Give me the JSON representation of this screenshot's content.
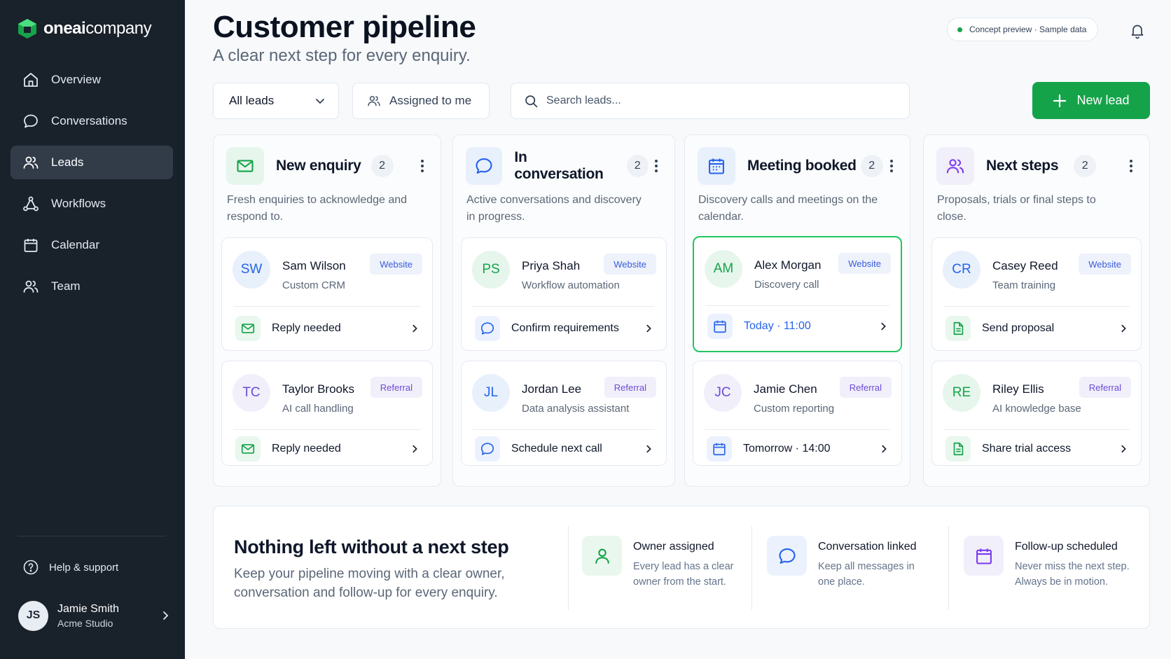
{
  "brand": {
    "name_bold": "oneai",
    "name_rest": "company"
  },
  "sidebar": {
    "items": [
      {
        "label": "Overview",
        "icon": "home-icon"
      },
      {
        "label": "Conversations",
        "icon": "chat-bubble-icon"
      },
      {
        "label": "Leads",
        "icon": "users-icon",
        "active": true
      },
      {
        "label": "Workflows",
        "icon": "workflow-icon"
      },
      {
        "label": "Calendar",
        "icon": "calendar-icon"
      },
      {
        "label": "Team",
        "icon": "team-icon"
      }
    ],
    "help": "Help & support",
    "user": {
      "initials": "JS",
      "name": "Jamie Smith",
      "org": "Acme Studio"
    }
  },
  "header": {
    "title": "Customer pipeline",
    "subtitle": "A clear next step for every enquiry.",
    "preview": "Concept preview · Sample data"
  },
  "toolbar": {
    "filter": "All leads",
    "assigned": "Assigned to me",
    "search_placeholder": "Search leads...",
    "new_lead": "New lead"
  },
  "colors": {
    "accent": "#15a34a",
    "sidebar": "#19212b"
  },
  "columns": [
    {
      "title": "New enquiry",
      "count": "2",
      "icon": "envelope-icon",
      "desc": "Fresh enquiries to acknowledge and respond to.",
      "cards": [
        {
          "initials": "SW",
          "name": "Sam Wilson",
          "sub": "Custom CRM",
          "tag": "Website",
          "action": "Reply needed",
          "action_icon": "envelope-icon"
        },
        {
          "initials": "TC",
          "name": "Taylor Brooks",
          "sub": "AI call handling",
          "tag": "Referral",
          "action": "Reply needed",
          "action_icon": "envelope-icon"
        }
      ]
    },
    {
      "title": "In conversation",
      "count": "2",
      "icon": "chat-bubble-icon",
      "desc": "Active conversations and discovery in progress.",
      "cards": [
        {
          "initials": "PS",
          "name": "Priya Shah",
          "sub": "Workflow automation",
          "tag": "Website",
          "action": "Confirm requirements",
          "action_icon": "chat-bubble-icon"
        },
        {
          "initials": "JL",
          "name": "Jordan Lee",
          "sub": "Data analysis assistant",
          "tag": "Referral",
          "action": "Schedule next call",
          "action_icon": "chat-bubble-icon"
        }
      ]
    },
    {
      "title": "Meeting booked",
      "count": "2",
      "icon": "calendar-icon",
      "desc": "Discovery calls and meetings on the calendar.",
      "cards": [
        {
          "initials": "AM",
          "name": "Alex Morgan",
          "sub": "Discovery call",
          "tag": "Website",
          "action": "Today · 11:00",
          "action_icon": "calendar-icon",
          "highlighted": true
        },
        {
          "initials": "JC",
          "name": "Jamie Chen",
          "sub": "Custom reporting",
          "tag": "Referral",
          "action": "Tomorrow · 14:00",
          "action_icon": "calendar-icon"
        }
      ]
    },
    {
      "title": "Next steps",
      "count": "2",
      "icon": "users-icon",
      "desc": "Proposals, trials or final steps to close.",
      "cards": [
        {
          "initials": "CR",
          "name": "Casey Reed",
          "sub": "Team training",
          "tag": "Website",
          "action": "Send proposal",
          "action_icon": "document-icon"
        },
        {
          "initials": "RE",
          "name": "Riley Ellis",
          "sub": "AI knowledge base",
          "tag": "Referral",
          "action": "Share trial access",
          "action_icon": "document-icon"
        }
      ]
    }
  ],
  "banner": {
    "title": "Nothing left without a next step",
    "desc": "Keep your pipeline moving with a clear owner, conversation and follow-up for every enquiry.",
    "features": [
      {
        "title": "Owner assigned",
        "desc": "Every lead has a clear owner from the start.",
        "icon": "user-icon"
      },
      {
        "title": "Conversation linked",
        "desc": "Keep all messages in one place.",
        "icon": "chat-bubble-icon"
      },
      {
        "title": "Follow-up scheduled",
        "desc": "Never miss the next step. Always be in motion.",
        "icon": "calendar-icon"
      }
    ]
  }
}
